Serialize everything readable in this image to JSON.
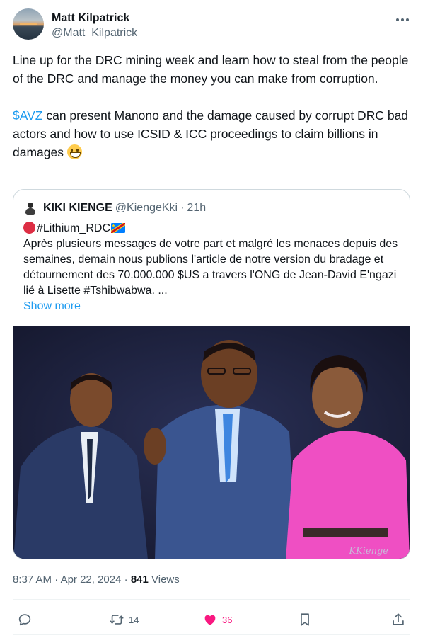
{
  "author": {
    "name": "Matt Kilpatrick",
    "handle": "@Matt_Kilpatrick",
    "more_icon": "more-icon"
  },
  "tweet": {
    "line1": "Line up for the DRC mining week and learn how to steal from the people of the DRC and manage the money you can make from corruption.",
    "cashtag": "$AVZ",
    "line2": " can present Manono and the damage caused by corrupt DRC bad actors and how to use ICSID & ICC proceedings to claim billions in damages ",
    "emoji": "grinning-face-icon"
  },
  "quote": {
    "name": "KIKI KIENGE",
    "handle": "@KiengeKki",
    "separator": "·",
    "time": "21h",
    "hashtag": "#Lithium_RDC",
    "body": "Après plusieurs messages de votre part et malgré les menaces depuis des semaines, demain nous publions l'article de notre version du bradage et détournement des 70.000.000 $US a travers l'ONG de Jean-David E'ngazi lié à Lisette #Tshibwabwa. ...",
    "show_more": "Show more",
    "watermark": "KKienge"
  },
  "meta": {
    "time": "8:37 AM",
    "dot1": " · ",
    "date": "Apr 22, 2024",
    "dot2": " · ",
    "views": "841",
    "views_label": " Views"
  },
  "actions": {
    "reply_count": "",
    "retweet_count": "14",
    "like_count": "36"
  },
  "colors": {
    "accent": "#1d9bf0",
    "like": "#f91880",
    "secondary_text": "#536471"
  }
}
